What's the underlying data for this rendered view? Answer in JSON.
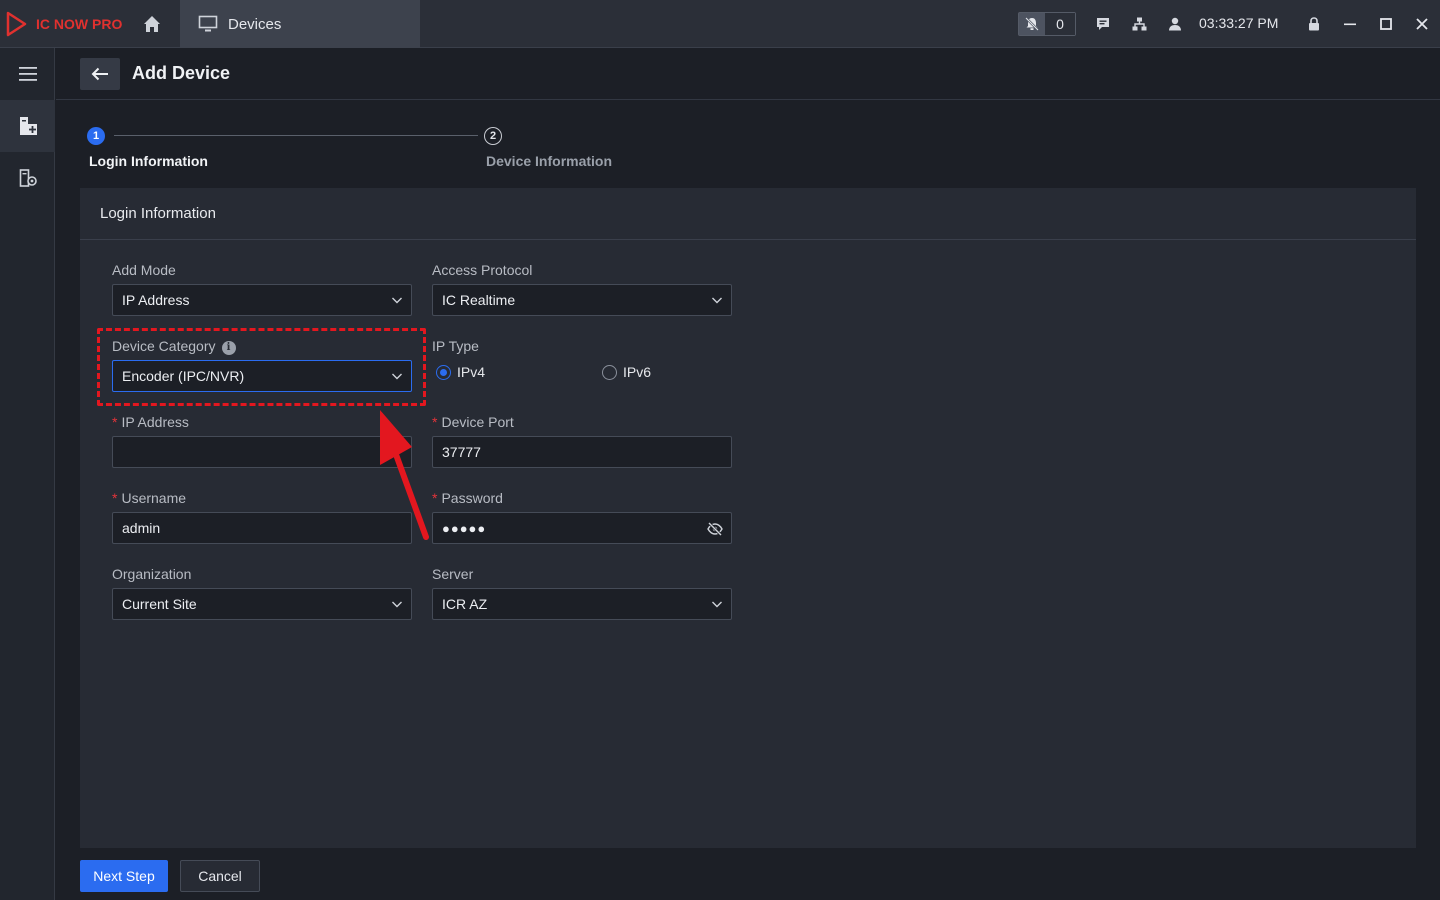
{
  "app": {
    "name": "IC NOW PRO",
    "brand_color": "#e0312f",
    "accent_color": "#2b6cf0"
  },
  "titlebar": {
    "tab_label": "Devices",
    "alarm_count": "0",
    "time": "03:33:27 PM",
    "icons": [
      "home-icon",
      "monitor-icon",
      "bell-muted-icon",
      "message-icon",
      "network-icon",
      "user-icon",
      "lock-icon",
      "minimize-icon",
      "maximize-icon",
      "close-icon"
    ]
  },
  "rail": {
    "icons": [
      "menu-icon",
      "add-device-icon",
      "device-settings-icon"
    ]
  },
  "header": {
    "title": "Add Device"
  },
  "steps": [
    {
      "number": "1",
      "label": "Login Information",
      "active": true
    },
    {
      "number": "2",
      "label": "Device Information",
      "active": false
    }
  ],
  "panel": {
    "title": "Login Information",
    "add_mode": {
      "label": "Add Mode",
      "value": "IP Address"
    },
    "access_protocol": {
      "label": "Access Protocol",
      "value": "IC Realtime"
    },
    "device_category": {
      "label": "Device Category",
      "value": "Encoder (IPC/NVR)"
    },
    "ip_type": {
      "label": "IP Type",
      "options": [
        "IPv4",
        "IPv6"
      ],
      "selected": "IPv4"
    },
    "ip_address": {
      "label": "IP Address",
      "value": "",
      "required": true
    },
    "device_port": {
      "label": "Device Port",
      "value": "37777",
      "required": true
    },
    "username": {
      "label": "Username",
      "value": "admin",
      "required": true
    },
    "password": {
      "label": "Password",
      "value": "●●●●●",
      "required": true
    },
    "organization": {
      "label": "Organization",
      "value": "Current Site"
    },
    "server": {
      "label": "Server",
      "value": "ICR AZ"
    },
    "required_mark": "*",
    "info_mark": "i"
  },
  "footer": {
    "next_label": "Next Step",
    "cancel_label": "Cancel"
  }
}
